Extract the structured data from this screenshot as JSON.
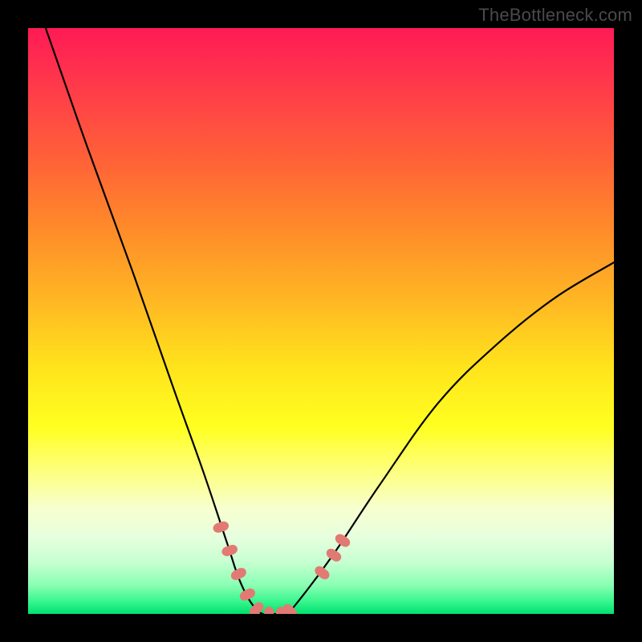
{
  "watermark": "TheBottleneck.com",
  "chart_data": {
    "type": "line",
    "title": "",
    "xlabel": "",
    "ylabel": "",
    "xlim": [
      0,
      100
    ],
    "ylim": [
      0,
      100
    ],
    "series": [
      {
        "name": "bottleneck-curve",
        "x": [
          3,
          10,
          18,
          25,
          30,
          34,
          36,
          38,
          40,
          42,
          44,
          46,
          52,
          60,
          70,
          80,
          90,
          100
        ],
        "y": [
          100,
          80,
          58,
          38,
          24,
          12,
          6,
          2,
          0,
          0,
          0,
          2,
          10,
          22,
          36,
          46,
          54,
          60
        ]
      }
    ],
    "markers": [
      {
        "name": "left-cluster",
        "points": [
          {
            "x": 33,
            "y": 15
          },
          {
            "x": 34.5,
            "y": 11
          },
          {
            "x": 36,
            "y": 7
          },
          {
            "x": 37.5,
            "y": 3.5
          },
          {
            "x": 39,
            "y": 1
          },
          {
            "x": 41,
            "y": 0
          },
          {
            "x": 43,
            "y": 0
          },
          {
            "x": 44.5,
            "y": 0.5
          }
        ]
      },
      {
        "name": "right-cluster",
        "points": [
          {
            "x": 50,
            "y": 7
          },
          {
            "x": 52,
            "y": 10
          },
          {
            "x": 53.5,
            "y": 12.5
          }
        ]
      }
    ],
    "colors": {
      "curve": "#000000",
      "marker": "#e27a74"
    }
  }
}
